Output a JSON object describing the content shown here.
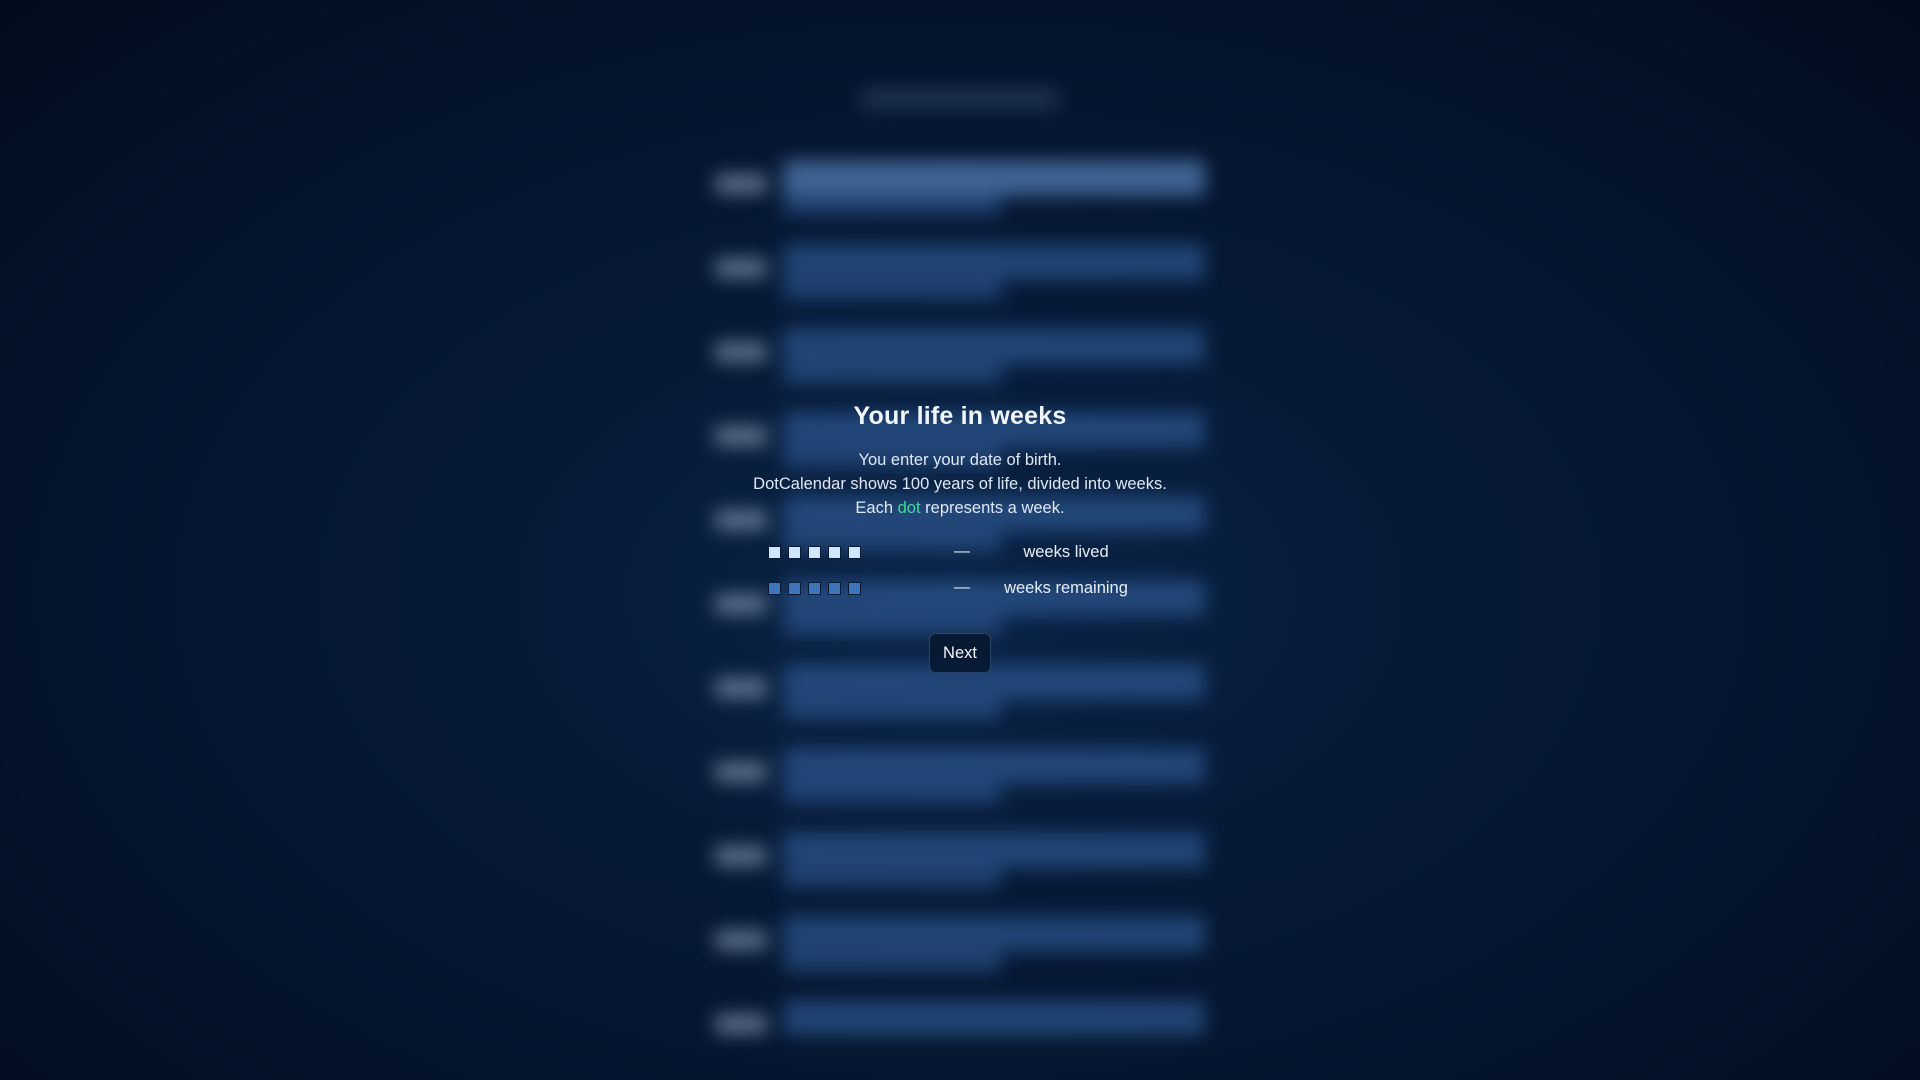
{
  "onboarding": {
    "title": "Your life in weeks",
    "description_line_1": "You enter your date of birth.",
    "description_line_2": "DotCalendar shows 100 years of life, divided into weeks.",
    "description_line_3_before": "Each ",
    "description_line_3_accent": "dot",
    "description_line_3_after": " represents a week.",
    "legend": {
      "lived_dash": "—",
      "lived_label": "weeks lived",
      "remaining_dash": "—",
      "remaining_label": "weeks remaining"
    },
    "next_label": "Next"
  },
  "colors": {
    "background": "#03112a",
    "accent_green": "#3ddc97",
    "lived_square": "#cfe6fb",
    "remaining_square": "#3f76bb"
  }
}
